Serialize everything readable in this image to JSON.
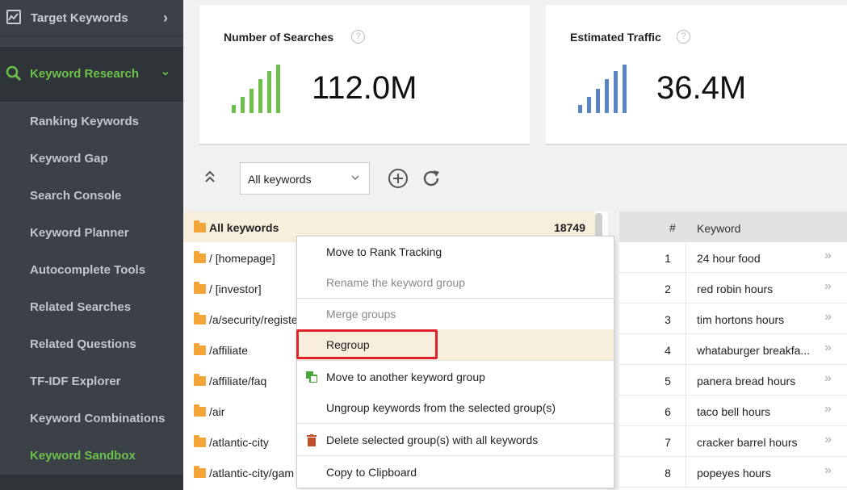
{
  "sidebar": {
    "top_item": "Target Keywords",
    "section": "Keyword Research",
    "items": [
      "Ranking Keywords",
      "Keyword Gap",
      "Search Console",
      "Keyword Planner",
      "Autocomplete Tools",
      "Related Searches",
      "Related Questions",
      "TF-IDF Explorer",
      "Keyword Combinations",
      "Keyword Sandbox"
    ],
    "active_item": "Keyword Sandbox",
    "accent_color": "#6cc04a"
  },
  "cards": {
    "searches": {
      "title": "Number of Searches",
      "value": "112.0M",
      "bar_color": "#6cc04a",
      "icon": "bar-signal-icon"
    },
    "traffic": {
      "title": "Estimated Traffic",
      "value": "36.4M",
      "bar_color": "#5a84c4",
      "icon": "bar-signal-icon"
    },
    "help_glyph": "?"
  },
  "toolbar": {
    "filter_value": "All keywords",
    "collapse_glyph": "⌃",
    "dropdown_glyph": "⌄"
  },
  "groups": {
    "rows": [
      {
        "name": "All keywords",
        "count": "18749"
      },
      {
        "name": "/ [homepage]"
      },
      {
        "name": "/ [investor]"
      },
      {
        "name": "/a/security/registe"
      },
      {
        "name": "/affiliate"
      },
      {
        "name": "/affiliate/faq"
      },
      {
        "name": "/air"
      },
      {
        "name": "/atlantic-city"
      },
      {
        "name": "/atlantic-city/gam"
      }
    ]
  },
  "keywords": {
    "header_num": "#",
    "header_keyword": "Keyword",
    "rows": [
      {
        "n": "1",
        "kw": "24 hour food"
      },
      {
        "n": "2",
        "kw": "red robin hours"
      },
      {
        "n": "3",
        "kw": "tim hortons hours"
      },
      {
        "n": "4",
        "kw": "whataburger breakfa..."
      },
      {
        "n": "5",
        "kw": "panera bread hours"
      },
      {
        "n": "6",
        "kw": "taco bell hours"
      },
      {
        "n": "7",
        "kw": "cracker barrel hours"
      },
      {
        "n": "8",
        "kw": "popeyes hours"
      }
    ],
    "go_glyph": "»"
  },
  "context_menu": {
    "items": [
      "Move to Rank Tracking",
      "Rename the keyword group",
      "Merge groups",
      "Regroup",
      "Move to another keyword group",
      "Ungroup keywords from the selected group(s)",
      "Delete selected group(s) with all keywords",
      "Copy to Clipboard"
    ],
    "highlight_color": "#e0202a"
  }
}
